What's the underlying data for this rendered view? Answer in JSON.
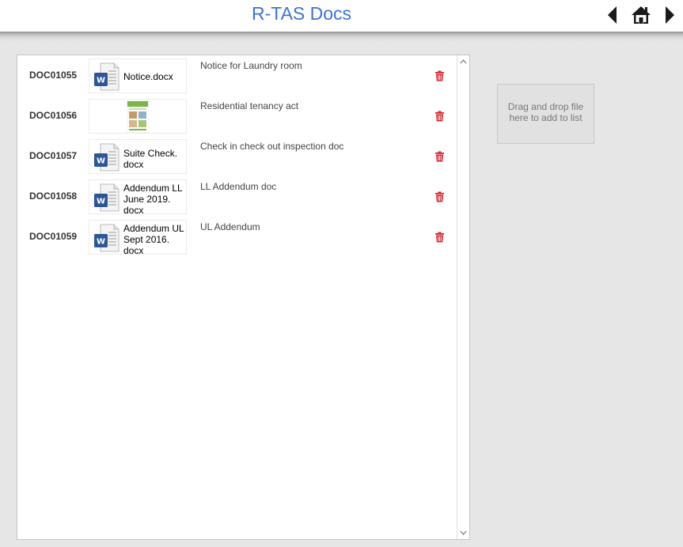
{
  "header": {
    "title": "R-TAS Docs",
    "back_icon": "caret-left-icon",
    "home_icon": "home-icon",
    "forward_icon": "caret-right-icon",
    "title_color": "#3a73d8"
  },
  "documents": [
    {
      "id": "DOC01055",
      "thumb_type": "word",
      "file_name_lines": [
        "Notice.docx"
      ],
      "description": "Notice for Laundry room"
    },
    {
      "id": "DOC01056",
      "thumb_type": "image",
      "file_name_lines": [],
      "description": "Residential tenancy act"
    },
    {
      "id": "DOC01057",
      "thumb_type": "word",
      "file_name_lines": [
        "Suite Check.",
        "docx"
      ],
      "description": "Check in check out inspection doc"
    },
    {
      "id": "DOC01058",
      "thumb_type": "word",
      "file_name_lines": [
        "Addendum LL",
        "June 2019.",
        "docx"
      ],
      "description": "LL Addendum doc"
    },
    {
      "id": "DOC01059",
      "thumb_type": "word",
      "file_name_lines": [
        "Addendum UL",
        "Sept 2016.",
        "docx"
      ],
      "description": "UL Addendum"
    }
  ],
  "delete_icon": "trash-icon",
  "delete_color": "#d9262e",
  "drop_zone": {
    "text": "Drag and drop file here to add to list"
  }
}
